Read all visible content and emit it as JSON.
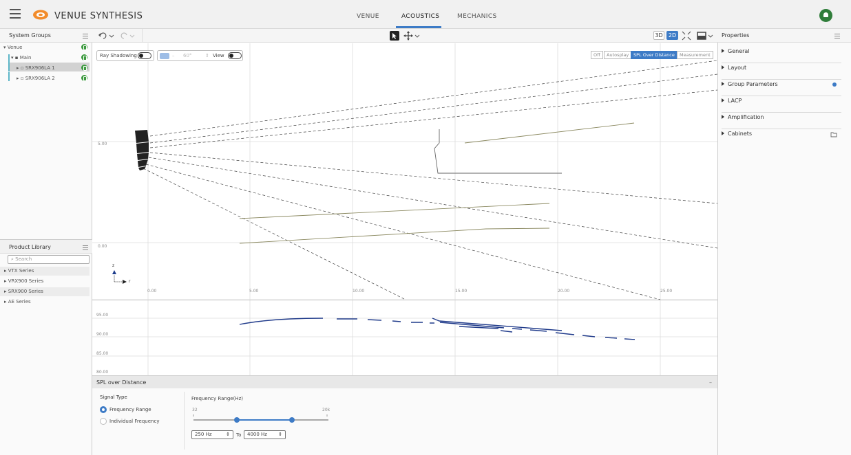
{
  "app": {
    "title": "VENUE SYNTHESIS"
  },
  "tabs": [
    {
      "label": "VENUE",
      "active": false
    },
    {
      "label": "ACOUSTICS",
      "active": true
    },
    {
      "label": "MECHANICS",
      "active": false
    }
  ],
  "left_panel": {
    "system_groups_title": "System Groups",
    "tree": [
      {
        "label": "▾ Venue"
      },
      {
        "label": "▾ ▪ Main"
      },
      {
        "label": "▸ ▫ SRX906LA 1"
      },
      {
        "label": "▸ ▫ SRX906LA 2"
      }
    ],
    "product_library_title": "Product Library",
    "search_placeholder": "Search",
    "series": [
      "▸ VTX Series",
      "▸ VRX900 Series",
      "▸ SRX900 Series",
      "▸ AE Series"
    ]
  },
  "toolbar": {
    "view_3d": "3D",
    "view_2d": "2D"
  },
  "canvas": {
    "ray_shadowing_label": "Ray Shadowing",
    "angle_value": "60°",
    "view_label": "View",
    "modes": [
      {
        "label": "Off",
        "active": false
      },
      {
        "label": "Autosplay",
        "active": false
      },
      {
        "label": "SPL Over Distance",
        "active": true
      },
      {
        "label": "Measurement",
        "active": false
      }
    ],
    "y_labels": [
      "5.00",
      "0.00"
    ],
    "x_labels": [
      "0.00",
      "5.00",
      "10.00",
      "15.00",
      "20.00",
      "25.00"
    ],
    "axis_z": "z",
    "axis_r": "r"
  },
  "spl_chart": {
    "y_labels": [
      "95.00",
      "90.00",
      "85.00",
      "80.00"
    ]
  },
  "spl_panel": {
    "title": "SPL over Distance",
    "collapse_symbol": "–",
    "signal_type_label": "Signal Type",
    "option_range": "Frequency Range",
    "option_individual": "Individual Frequency",
    "freq_range_label": "Frequency Range(Hz)",
    "min_label": "32",
    "max_label": "20k",
    "from_value": "250 Hz",
    "to_label": "To",
    "to_value": "4000 Hz"
  },
  "properties": {
    "title": "Properties",
    "items": [
      "General",
      "Layout",
      "Group Parameters",
      "LACP",
      "Amplification",
      "Cabinets"
    ]
  },
  "colors": {
    "accent": "#3d7bc6",
    "status_green": "#3c9a3f",
    "spl_line": "#1f3a8a",
    "venue_line": "#8c8a62"
  }
}
